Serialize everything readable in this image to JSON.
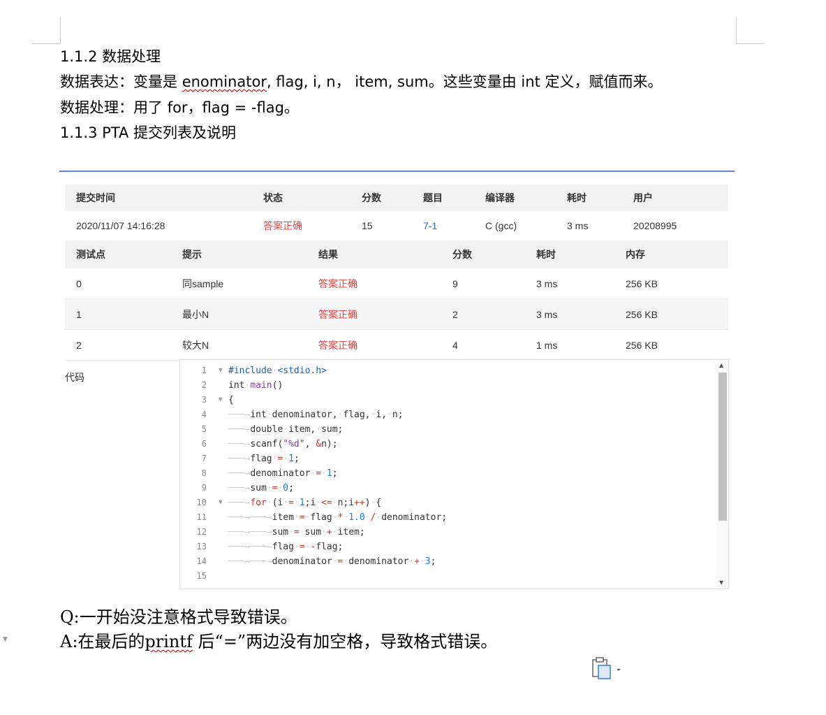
{
  "doc": {
    "heading1": "1.1.2 数据处理",
    "line1_prefix": "数据表达：变量是 ",
    "line1_squig": "enominator",
    "line1_suffix": ", flag, i, n， item, sum。这些变量由 int 定义，赋值而来。",
    "line2": "数据处理：用了 for，flag = -flag。",
    "heading2": "1.1.3 PTA 提交列表及说明"
  },
  "submission": {
    "headers": [
      "提交时间",
      "状态",
      "分数",
      "题目",
      "编译器",
      "耗时",
      "用户"
    ],
    "row": {
      "time": "2020/11/07 14:16:28",
      "status": "答案正确",
      "score": "15",
      "problem": "7-1",
      "compiler": "C (gcc)",
      "elapsed": "3 ms",
      "user": "20208995"
    }
  },
  "tests": {
    "headers": [
      "测试点",
      "提示",
      "结果",
      "分数",
      "耗时",
      "内存"
    ],
    "rows": [
      {
        "id": "0",
        "hint": "同sample",
        "result": "答案正确",
        "score": "9",
        "time": "3 ms",
        "mem": "256 KB"
      },
      {
        "id": "1",
        "hint": "最小N",
        "result": "答案正确",
        "score": "2",
        "time": "3 ms",
        "mem": "256 KB"
      },
      {
        "id": "2",
        "hint": "较大N",
        "result": "答案正确",
        "score": "4",
        "time": "1 ms",
        "mem": "256 KB"
      }
    ]
  },
  "code": {
    "label": "代码",
    "line_numbers": [
      "1",
      "2",
      "3",
      "4",
      "5",
      "6",
      "7",
      "8",
      "9",
      "10",
      "11",
      "12",
      "13",
      "14",
      "15"
    ]
  },
  "qa": {
    "q": "Q:一开始没注意格式导致错误。",
    "a_prefix": "A:在最后的",
    "a_squig": "printf",
    "a_suffix": " 后“=”两边没有加空格，导致格式错误。"
  },
  "colors": {
    "accent_red": "#e84545",
    "link_blue": "#2f6ec9",
    "rule_blue": "#5b86c8"
  }
}
